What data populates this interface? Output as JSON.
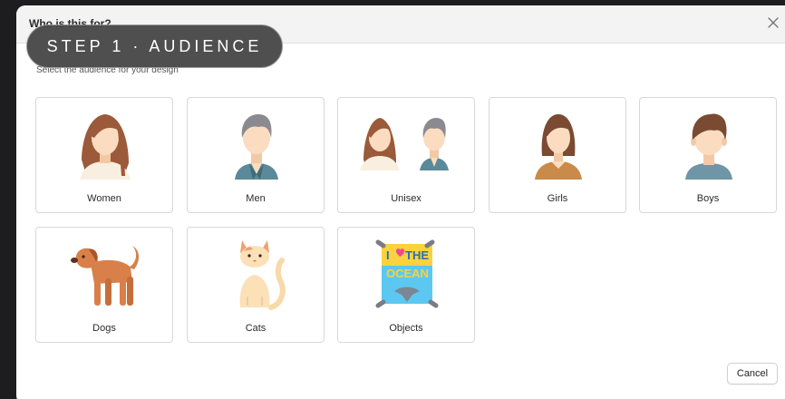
{
  "dialog": {
    "title": "Who is this for?",
    "subtitle": "Select the audience for your design",
    "step_label": "STEP 1 · AUDIENCE",
    "cancel_label": "Cancel"
  },
  "options": [
    {
      "label": "Women",
      "icon": "woman-icon"
    },
    {
      "label": "Men",
      "icon": "man-icon"
    },
    {
      "label": "Unisex",
      "icon": "unisex-icon"
    },
    {
      "label": "Girls",
      "icon": "girl-icon"
    },
    {
      "label": "Boys",
      "icon": "boy-icon"
    },
    {
      "label": "Dogs",
      "icon": "dog-icon"
    },
    {
      "label": "Cats",
      "icon": "cat-icon"
    },
    {
      "label": "Objects",
      "icon": "poster-icon",
      "icon_text": [
        "I ",
        "THE",
        "OCEAN"
      ]
    }
  ],
  "colors": {
    "skin": "#fbdcc0",
    "hair_brown": "#9b5a3a",
    "hair_gray": "#8b8a90",
    "shirt_teal": "#5a8a99",
    "shirt_cream": "#f8efe0",
    "dog_orange": "#d9804a",
    "poster_blue": "#5cc8f2",
    "poster_yellow": "#f9d23d",
    "heart_pink": "#ee4a8a"
  }
}
